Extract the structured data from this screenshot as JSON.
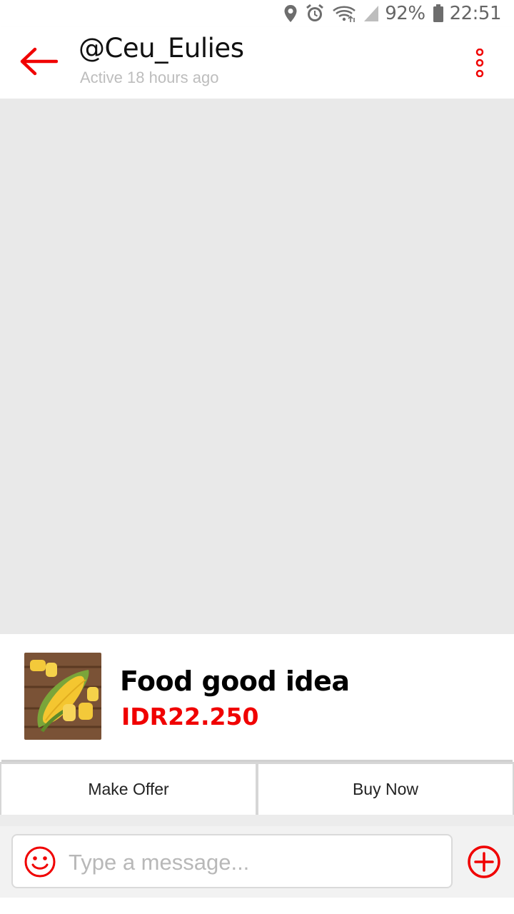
{
  "status_bar": {
    "battery": "92%",
    "time": "22:51",
    "icons": [
      "location-icon",
      "alarm-icon",
      "wifi-icon",
      "signal-icon",
      "battery-icon"
    ]
  },
  "header": {
    "username": "@Ceu_Eulies",
    "status": "Active 18 hours ago"
  },
  "product": {
    "name": "Food good idea",
    "price": "IDR22.250"
  },
  "actions": {
    "make_offer": "Make Offer",
    "buy_now": "Buy Now"
  },
  "composer": {
    "placeholder": "Type a message..."
  },
  "colors": {
    "accent": "#f00000",
    "chat_background": "#e9e9e9"
  }
}
